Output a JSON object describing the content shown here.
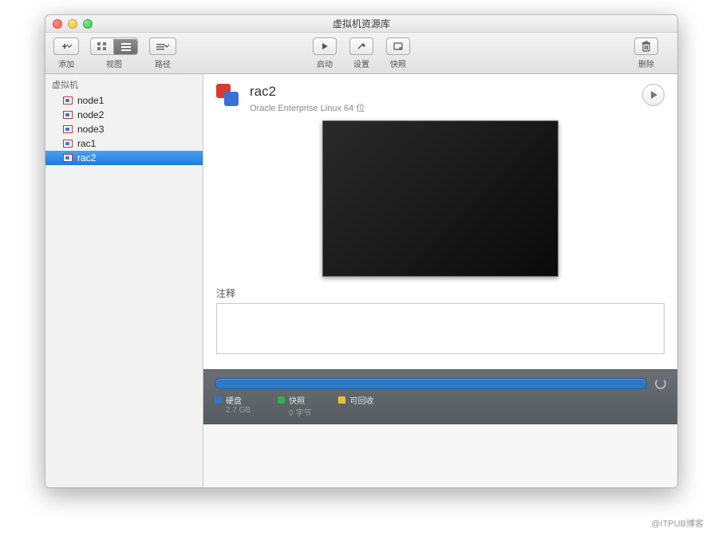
{
  "window": {
    "title": "虚拟机资源库"
  },
  "toolbar": {
    "add": "添加",
    "view": "视图",
    "path": "路径",
    "start": "启动",
    "settings": "设置",
    "snapshot": "快照",
    "delete": "删除"
  },
  "sidebar": {
    "header": "虚拟机",
    "items": [
      {
        "name": "node1",
        "selected": false
      },
      {
        "name": "node2",
        "selected": false
      },
      {
        "name": "node3",
        "selected": false
      },
      {
        "name": "rac1",
        "selected": false
      },
      {
        "name": "rac2",
        "selected": true
      }
    ]
  },
  "detail": {
    "name": "rac2",
    "subtitle": "Oracle Enterprise Linux 64 位",
    "notes_label": "注释",
    "notes_value": ""
  },
  "status": {
    "legend": [
      {
        "color": "blue",
        "label": "硬盘",
        "value": "2.7 GB"
      },
      {
        "color": "green",
        "label": "快照",
        "value": "0 字节"
      },
      {
        "color": "yellow",
        "label": "可回收",
        "value": ""
      }
    ]
  },
  "watermark": "@ITPUB博客"
}
